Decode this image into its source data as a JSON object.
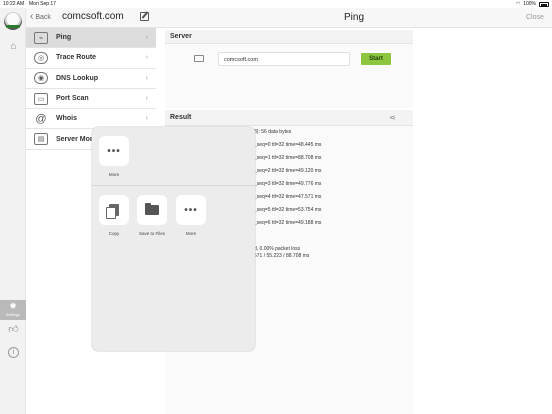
{
  "status_bar": {
    "time": "10:22 AM",
    "date": "Mon Sep 17",
    "battery": "100%"
  },
  "nav": {
    "back_label": "Back",
    "host_title": "comcsoft.com"
  },
  "header": {
    "title": "Ping",
    "close_label": "Close"
  },
  "menu": {
    "items": [
      {
        "label": "Ping",
        "icon": "ping-icon"
      },
      {
        "label": "Trace Route",
        "icon": "trace-route-icon"
      },
      {
        "label": "DNS Lookup",
        "icon": "eye-icon"
      },
      {
        "label": "Port Scan",
        "icon": "port-scan-icon"
      },
      {
        "label": "Whois",
        "icon": "at-icon"
      },
      {
        "label": "Server Mon",
        "icon": "server-monitor-icon"
      }
    ]
  },
  "rail": {
    "settings_label": "Settings"
  },
  "server": {
    "section_title": "Server",
    "host_value": "comcsoft.com",
    "start_label": "Start"
  },
  "result": {
    "section_title": "Result",
    "lines": [
      "3): 56 data bytes",
      "_seq=0 ttl=32 time=48.445 ms",
      "_seq=1 ttl=32 time=88.708 ms",
      "_seq=2 ttl=32 time=49.120 ms",
      "_seq=3 ttl=32 time=49.776 ms",
      "_seq=4 ttl=32 time=47.571 ms",
      "_seq=5 ttl=32 time=53.754 ms",
      "_seq=6 ttl=32 time=49.188 ms",
      "d, 0.00% packet loss",
      "571 / 55.223 / 88.708 ms"
    ]
  },
  "share_sheet": {
    "top_action": "More",
    "actions": [
      "Copy",
      "Save to Files",
      "More"
    ]
  },
  "colors": {
    "accent": "#8cc63f",
    "selected_row": "#dcdcdc"
  }
}
